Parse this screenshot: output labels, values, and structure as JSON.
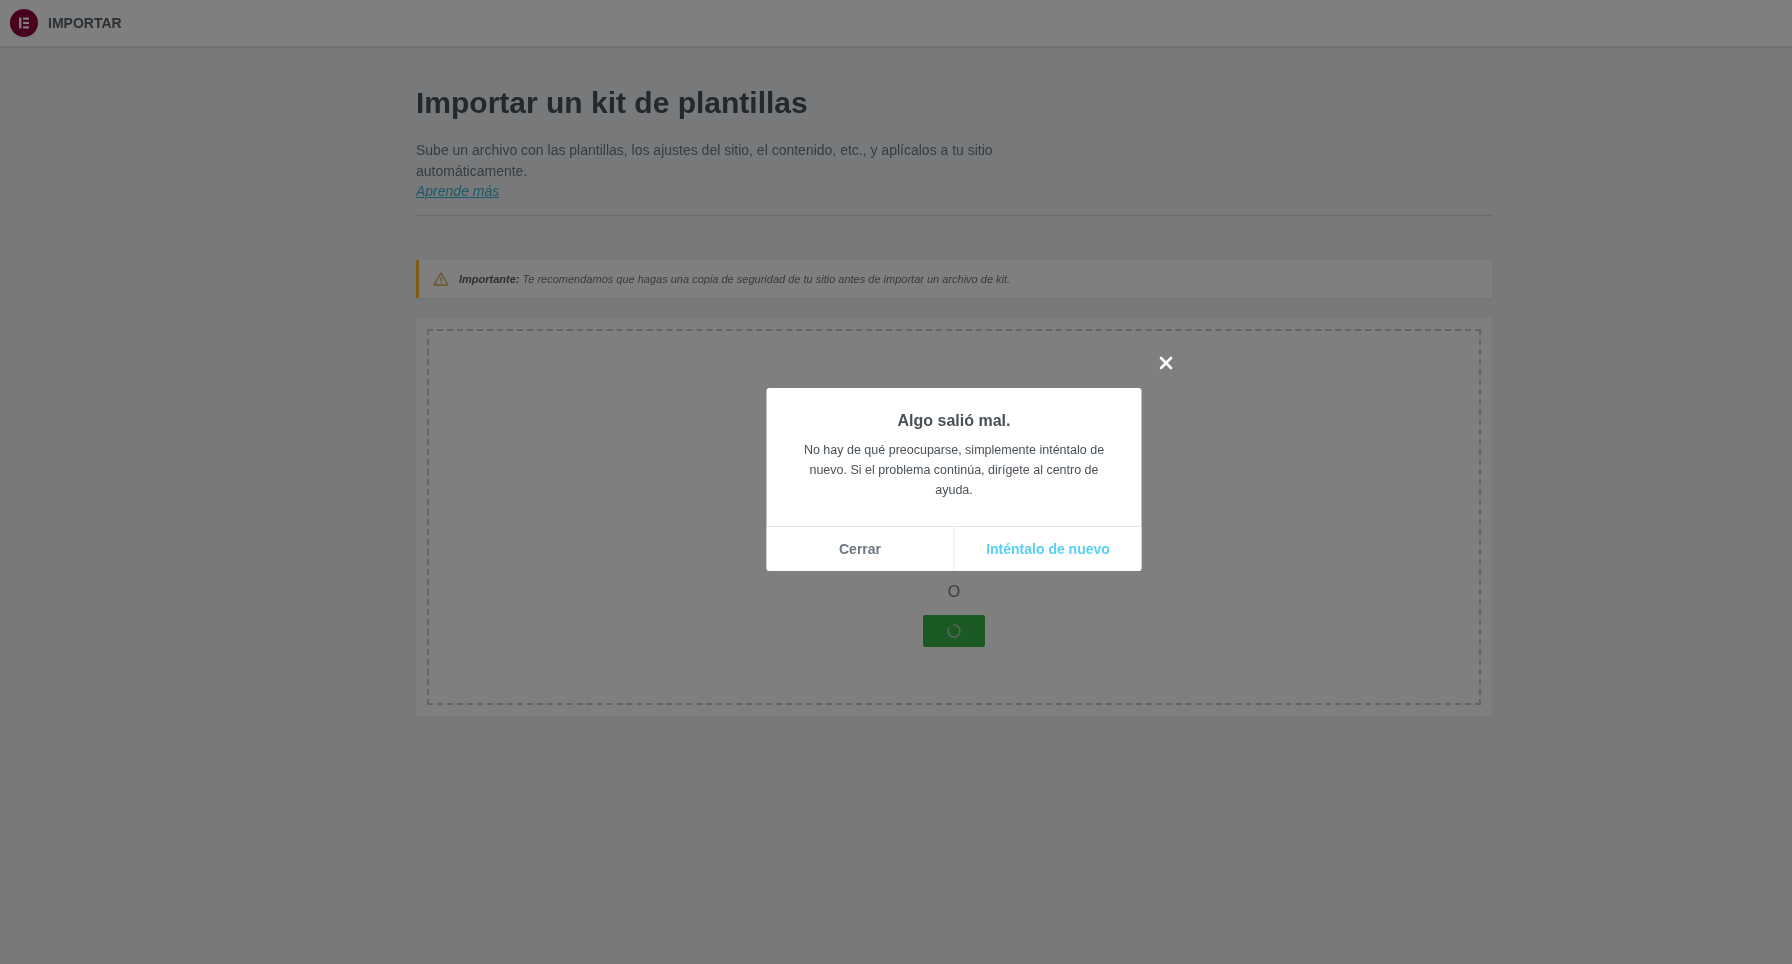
{
  "header": {
    "title": "IMPORTAR"
  },
  "page": {
    "title": "Importar un kit de plantillas",
    "description": "Sube un archivo con las plantillas, los ajustes del sitio, el contenido, etc., y aplícalos a tu sitio automáticamente.",
    "link": "Aprende más"
  },
  "notice": {
    "text": "**Importante:** Te recomendamos que hagas una copia de seguridad de tu sitio antes de importar un archivo de kit."
  },
  "dropzone": {
    "separator": "O",
    "button": {
      "loading": true
    }
  },
  "dialog": {
    "open": true,
    "title": "Algo salió mal.",
    "message": "No hay de qué preocuparse, simplemente inténtalo de nuevo. Si el problema continúa, dirígete al centro de ayuda.",
    "buttons": [
      {
        "label": "Cerrar",
        "kind": "secondary"
      },
      {
        "label": "Inténtalo de nuevo",
        "kind": "primary"
      }
    ]
  }
}
